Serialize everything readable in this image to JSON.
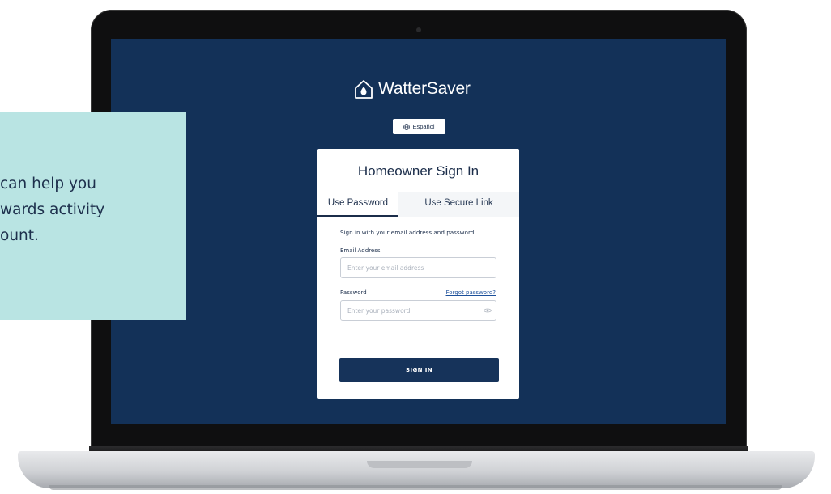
{
  "callout": {
    "line1": "can help you",
    "line2": "wards activity",
    "line3": "ount."
  },
  "app": {
    "brand_name": "WatterSaver",
    "language_button": "Español"
  },
  "signin": {
    "title": "Homeowner Sign In",
    "tabs": [
      {
        "label": "Use Password",
        "active": true
      },
      {
        "label": "Use Secure Link",
        "active": false
      }
    ],
    "instructions": "Sign in with your email address and password.",
    "email_label": "Email Address",
    "email_placeholder": "Enter your email address",
    "password_label": "Password",
    "forgot_label": "Forgot password?",
    "password_placeholder": "Enter your password",
    "submit_label": "SIGN IN"
  },
  "colors": {
    "screen_bg": "#133158",
    "primary": "#16335a",
    "callout_bg": "#b9e4e3"
  },
  "icons": {
    "brand": "house-water-drop-icon",
    "language": "globe-icon",
    "password_toggle": "eye-icon"
  }
}
